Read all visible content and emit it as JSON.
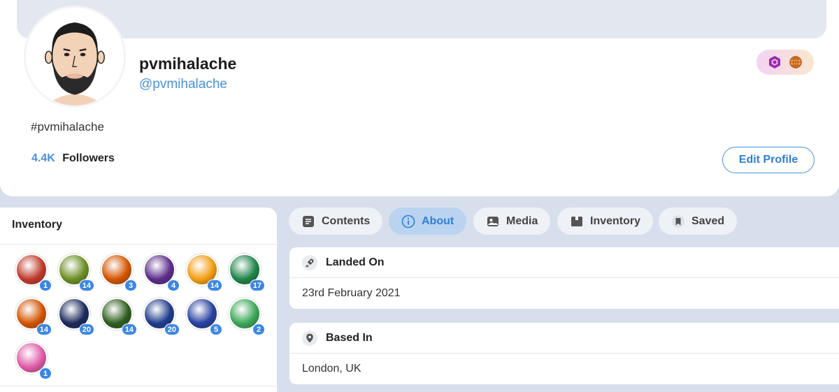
{
  "profile": {
    "display_name": "pvmihalache",
    "handle": "@pvmihalache",
    "bio": "#pvmihalache",
    "followers_count": "4.4K",
    "followers_label": "Followers",
    "edit_button": "Edit Profile",
    "badges": [
      "hexagon-badge-icon",
      "globe-badge-icon"
    ]
  },
  "inventory_panel": {
    "title": "Inventory",
    "items": [
      {
        "icon": "dragon-icon",
        "count": "1",
        "color": "#c0392b"
      },
      {
        "icon": "frog-icon",
        "count": "14",
        "color": "#6b8e23"
      },
      {
        "icon": "donut-icon",
        "count": "3",
        "color": "#d35400"
      },
      {
        "icon": "hodl-icon",
        "count": "4",
        "color": "#5b2c8a"
      },
      {
        "icon": "fire-fruit-icon",
        "count": "14",
        "color": "#f39c12"
      },
      {
        "icon": "clap-icon",
        "count": "17",
        "color": "#1e8449"
      },
      {
        "icon": "wizard-icon",
        "count": "14",
        "color": "#d35400"
      },
      {
        "icon": "diamond-hands-icon",
        "count": "20",
        "color": "#1b2a5c"
      },
      {
        "icon": "bull-icon",
        "count": "14",
        "color": "#2e5e1e"
      },
      {
        "icon": "gold-coin-icon",
        "count": "20",
        "color": "#1f3b8c"
      },
      {
        "icon": "trophy-icon",
        "count": "5",
        "color": "#2640a0"
      },
      {
        "icon": "ticket-icon",
        "count": "2",
        "color": "#3aa757"
      },
      {
        "icon": "unicorn-icon",
        "count": "1",
        "color": "#e05aa7"
      }
    ]
  },
  "tabs": [
    {
      "label": "Contents",
      "icon": "document-icon",
      "active": false
    },
    {
      "label": "About",
      "icon": "info-icon",
      "active": true
    },
    {
      "label": "Media",
      "icon": "image-icon",
      "active": false
    },
    {
      "label": "Inventory",
      "icon": "box-icon",
      "active": false
    },
    {
      "label": "Saved",
      "icon": "bookmark-icon",
      "active": false
    }
  ],
  "about": {
    "landed_on": {
      "label": "Landed On",
      "value": "23rd February 2021",
      "icon": "rocket-icon"
    },
    "based_in": {
      "label": "Based In",
      "value": "London, UK",
      "icon": "location-pin-icon"
    }
  }
}
